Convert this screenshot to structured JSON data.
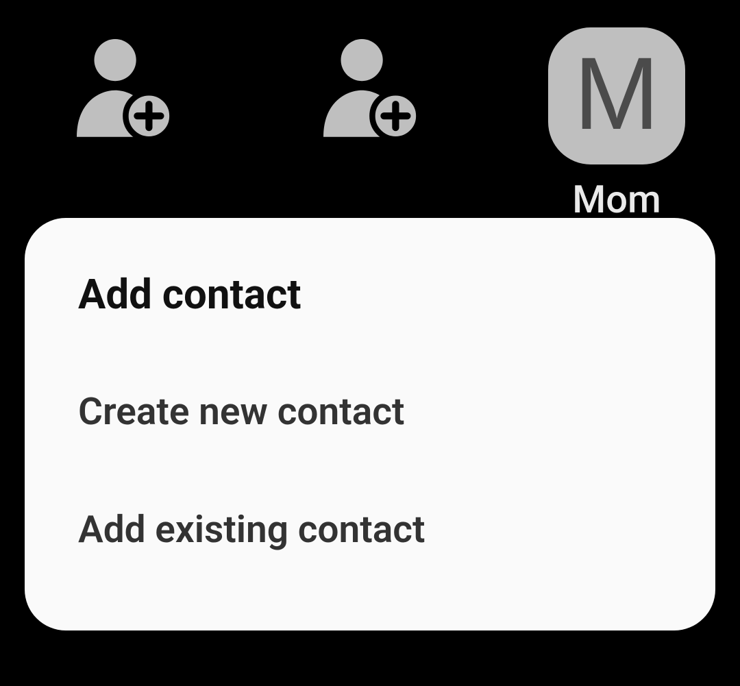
{
  "slots": {
    "contact": {
      "name": "Mom",
      "initial": "M"
    }
  },
  "menu": {
    "title": "Add contact",
    "options": [
      {
        "label": "Create new contact"
      },
      {
        "label": "Add existing contact"
      }
    ]
  },
  "colors": {
    "background": "#000000",
    "card": "#fafafa",
    "avatarBg": "#bfbfbf",
    "avatarFg": "#4b4b4b",
    "label": "#e9e9e9"
  }
}
